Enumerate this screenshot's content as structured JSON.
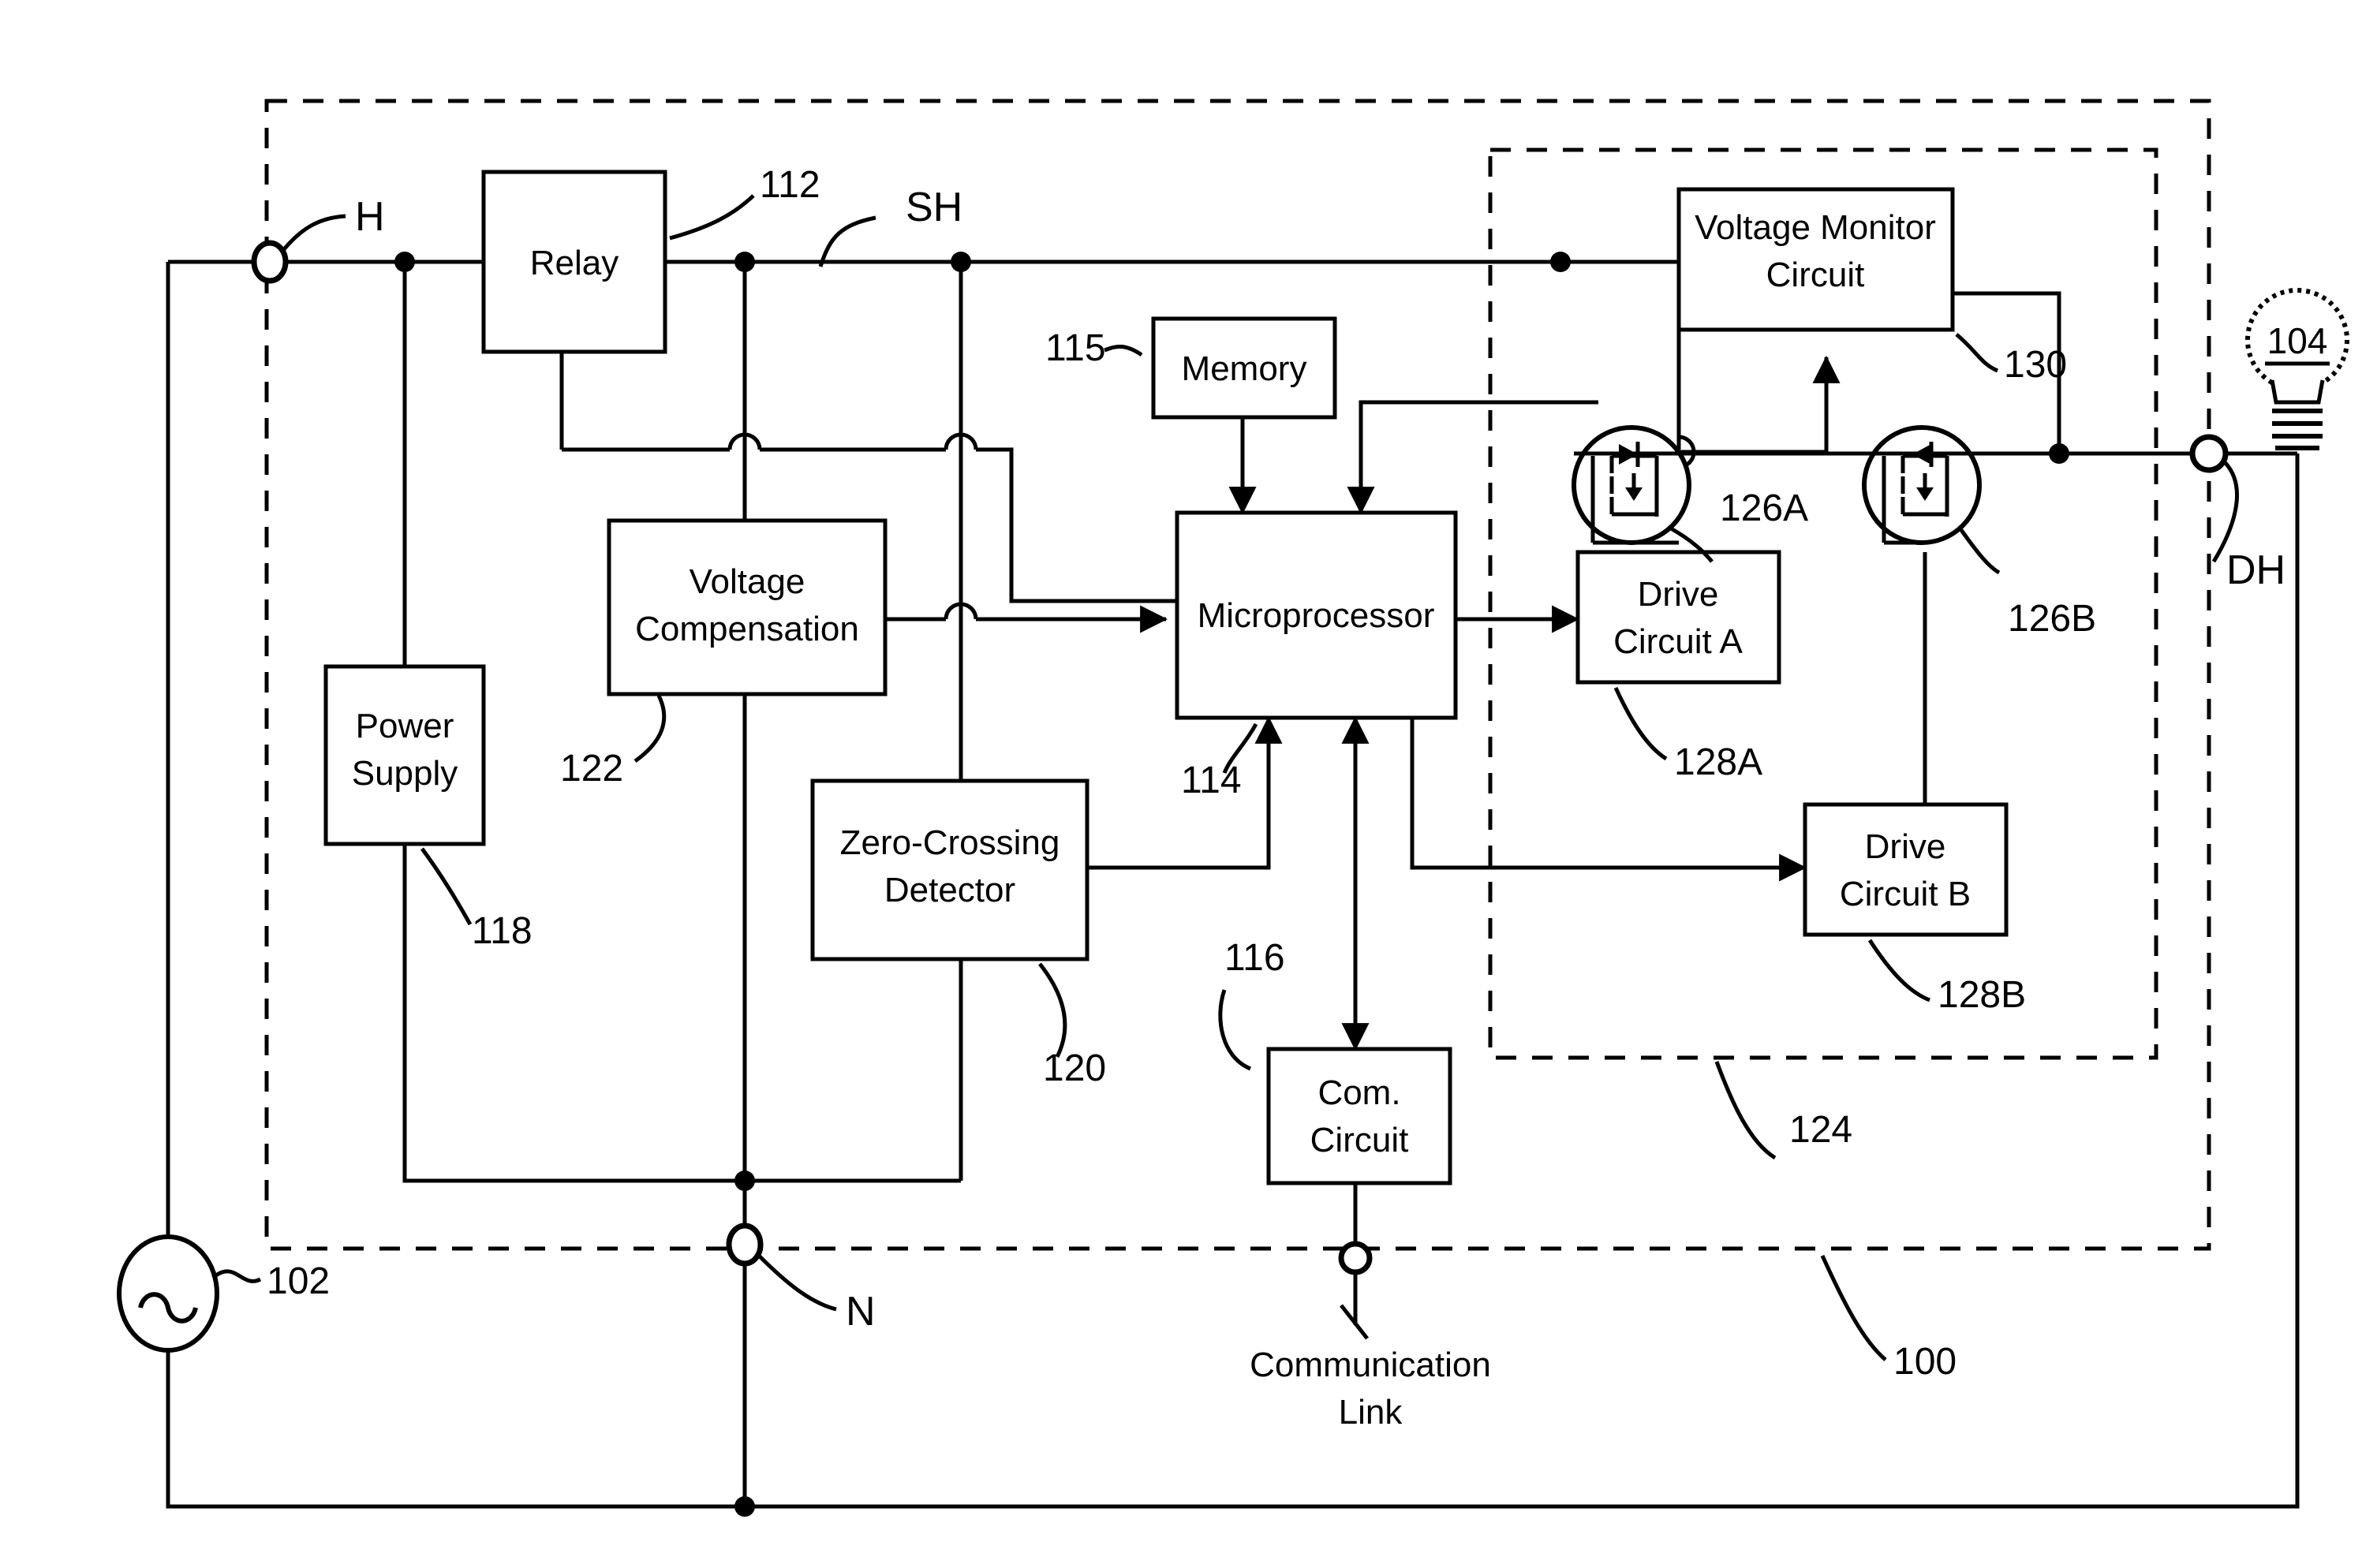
{
  "figure": {
    "type": "patent-block-diagram",
    "title": "Dimmer / load control device block diagram",
    "background_color": "#ffffff",
    "line_color": "#000000"
  },
  "terminals": [
    {
      "id": "H",
      "label": "H",
      "name": "hot-terminal"
    },
    {
      "id": "N",
      "label": "N",
      "name": "neutral-terminal"
    },
    {
      "id": "DH",
      "label": "DH",
      "name": "dimmed-hot-terminal"
    },
    {
      "id": "SH",
      "label": "SH",
      "name": "switched-hot-node"
    }
  ],
  "blocks": [
    {
      "id": "relay",
      "label": "Relay",
      "ref": "112"
    },
    {
      "id": "memory",
      "label": "Memory",
      "ref": "115"
    },
    {
      "id": "micro",
      "label": "Microprocessor",
      "ref": "114"
    },
    {
      "id": "vcomp",
      "label_line1": "Voltage",
      "label_line2": "Compensation",
      "ref": "122"
    },
    {
      "id": "psupply",
      "label_line1": "Power",
      "label_line2": "Supply",
      "ref": "118"
    },
    {
      "id": "zcd",
      "label_line1": "Zero-Crossing",
      "label_line2": "Detector",
      "ref": "120"
    },
    {
      "id": "com",
      "label_line1": "Com.",
      "label_line2": "Circuit",
      "ref": "116"
    },
    {
      "id": "vmon",
      "label_line1": "Voltage Monitor",
      "label_line2": "Circuit",
      "ref": "130"
    },
    {
      "id": "driveA",
      "label_line1": "Drive",
      "label_line2": "Circuit A",
      "ref": "128A"
    },
    {
      "id": "driveB",
      "label_line1": "Drive",
      "label_line2": "Circuit B",
      "ref": "128B"
    }
  ],
  "components": [
    {
      "id": "fetA",
      "name": "mosfet-a",
      "ref": "126A"
    },
    {
      "id": "fetB",
      "name": "mosfet-b",
      "ref": "126B"
    },
    {
      "id": "ac",
      "name": "ac-source",
      "ref": "102"
    },
    {
      "id": "lamp",
      "name": "lamp-load",
      "ref": "104"
    }
  ],
  "enclosures": [
    {
      "id": "device",
      "ref": "100",
      "style": "dashed"
    },
    {
      "id": "switch_bank",
      "ref": "124",
      "style": "dashed"
    }
  ],
  "labels": {
    "ref_112": "112",
    "ref_114": "114",
    "ref_115": "115",
    "ref_116": "116",
    "ref_118": "118",
    "ref_120": "120",
    "ref_122": "122",
    "ref_124": "124",
    "ref_126A": "126A",
    "ref_126B": "126B",
    "ref_128A": "128A",
    "ref_128B": "128B",
    "ref_130": "130",
    "ref_100": "100",
    "ref_102": "102",
    "ref_104": "104",
    "term_H": "H",
    "term_N": "N",
    "term_DH": "DH",
    "term_SH": "SH",
    "relay": "Relay",
    "memory": "Memory",
    "micro": "Microprocessor",
    "vcomp_1": "Voltage",
    "vcomp_2": "Compensation",
    "psupply_1": "Power",
    "psupply_2": "Supply",
    "zcd_1": "Zero-Crossing",
    "zcd_2": "Detector",
    "com_1": "Com.",
    "com_2": "Circuit",
    "vmon_1": "Voltage Monitor",
    "vmon_2": "Circuit",
    "driveA_1": "Drive",
    "driveA_2": "Circuit A",
    "driveB_1": "Drive",
    "driveB_2": "Circuit B",
    "comm_link_1": "Communication",
    "comm_link_2": "Link"
  }
}
